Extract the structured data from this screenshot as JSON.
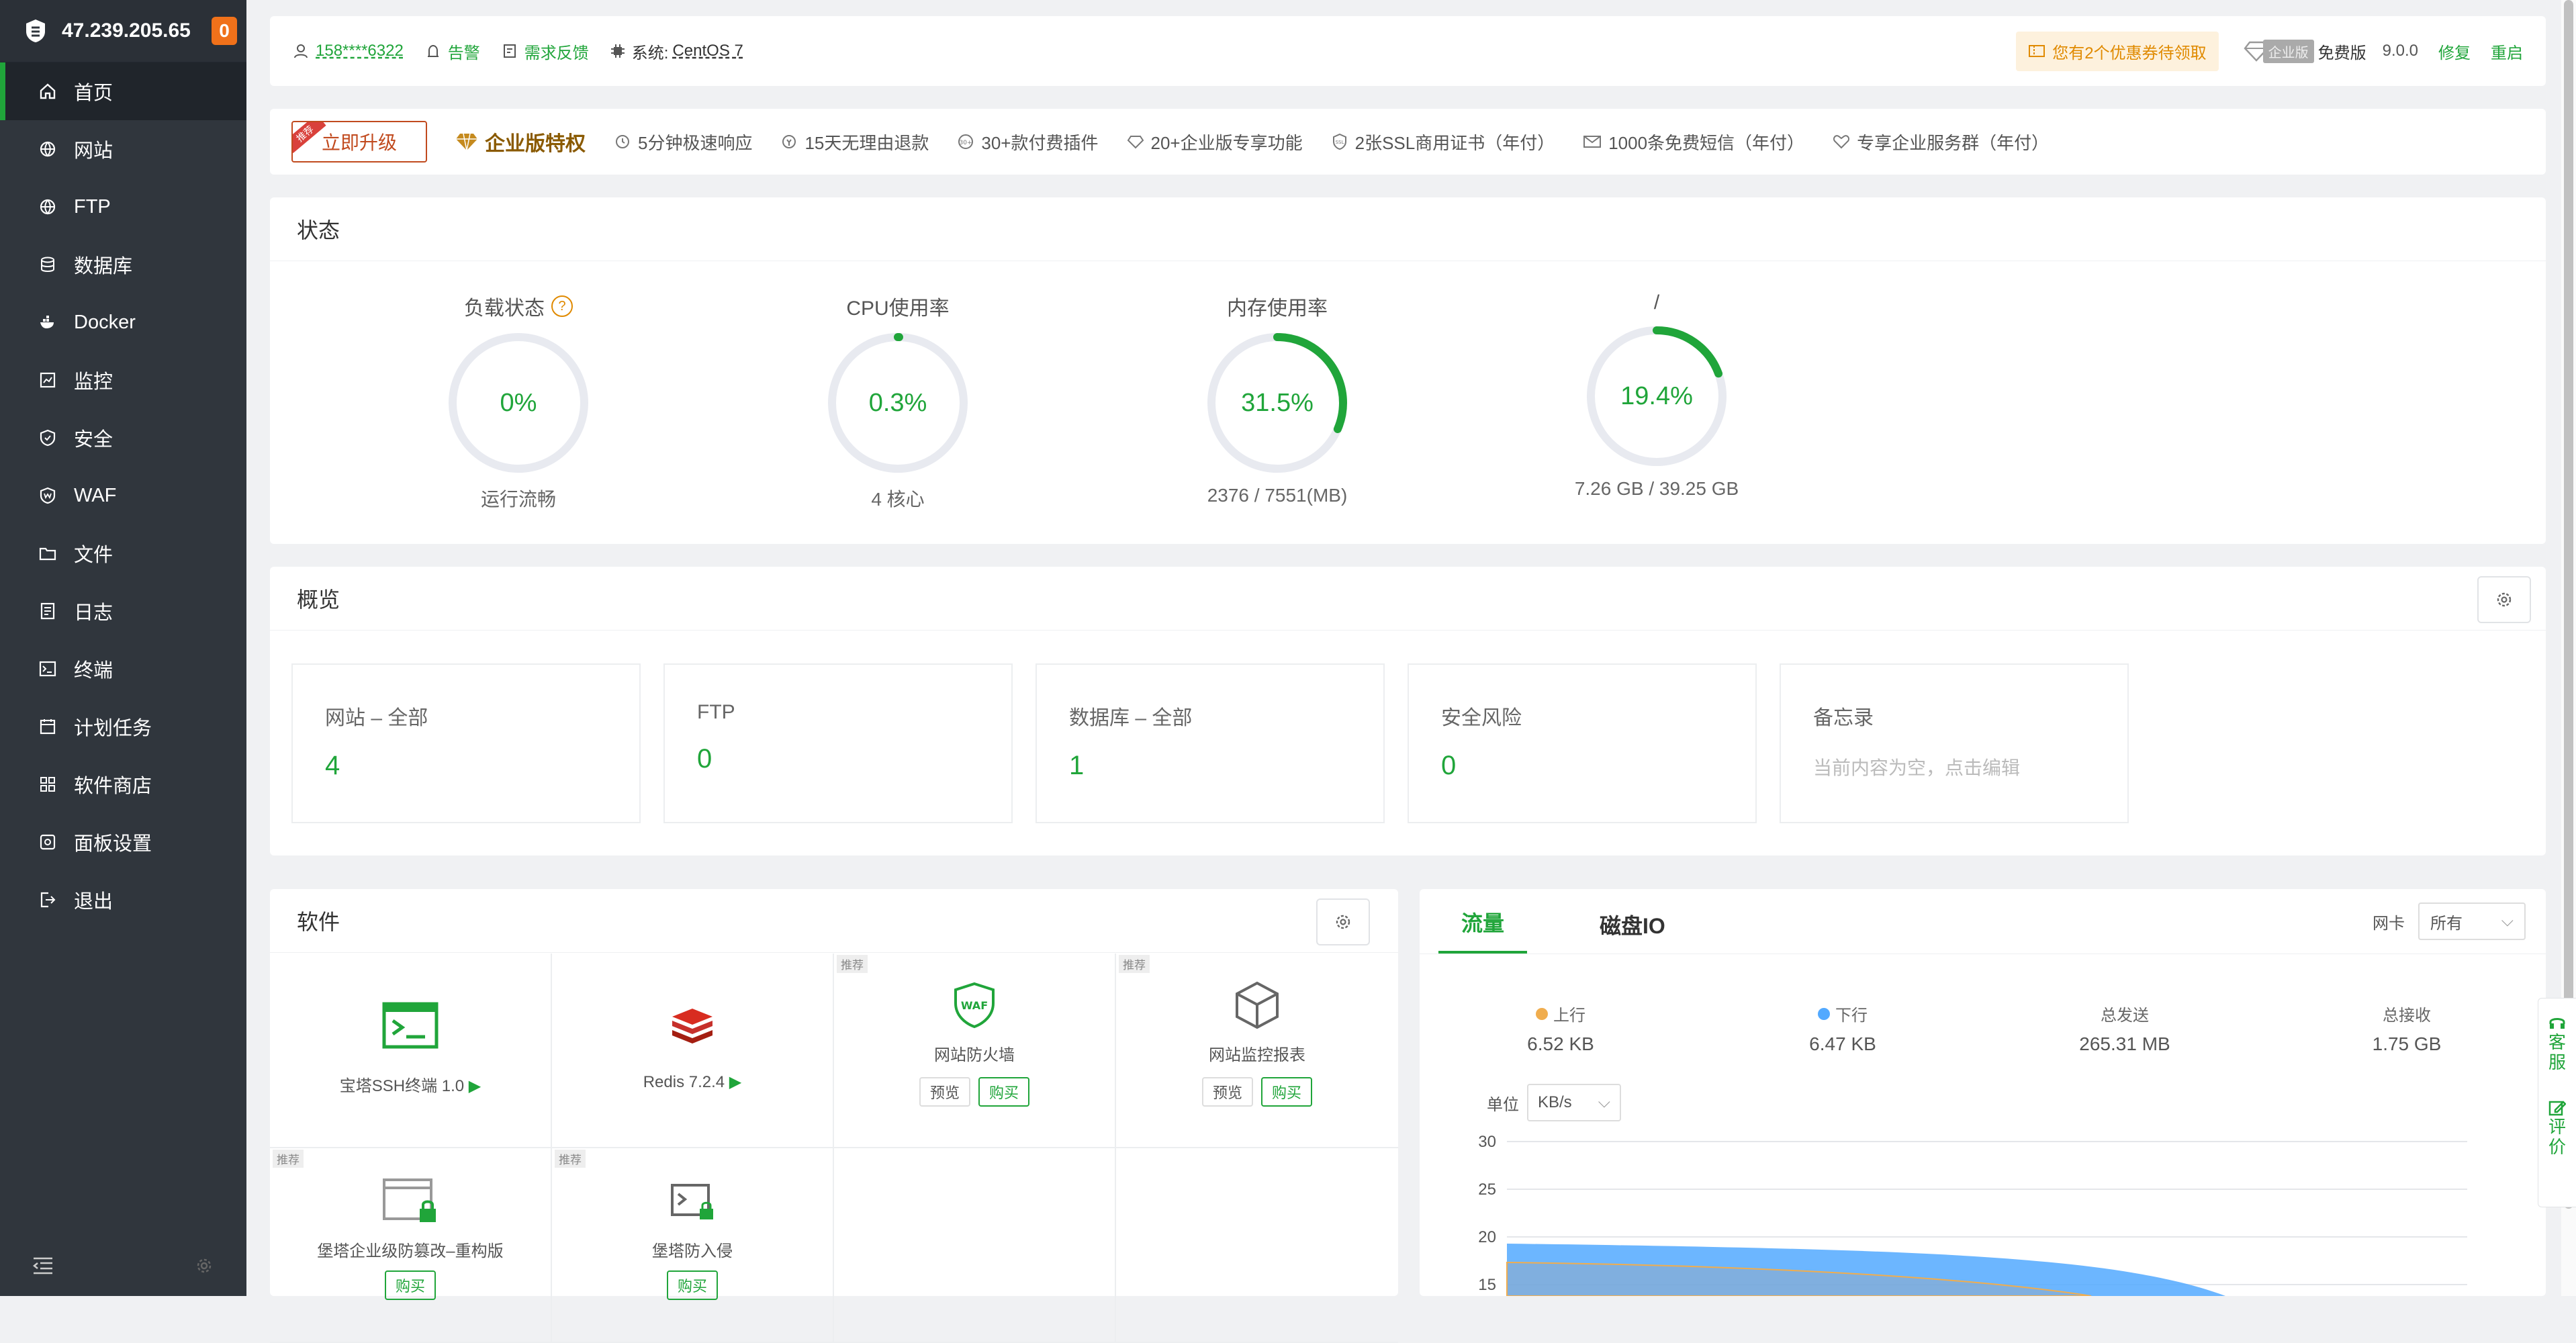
{
  "sidebar": {
    "ip": "47.239.205.65",
    "badge_count": "0",
    "items": [
      {
        "label": "首页",
        "icon": "home-icon",
        "active": true
      },
      {
        "label": "网站",
        "icon": "globe-icon"
      },
      {
        "label": "FTP",
        "icon": "globe-icon"
      },
      {
        "label": "数据库",
        "icon": "database-icon"
      },
      {
        "label": "Docker",
        "icon": "docker-icon"
      },
      {
        "label": "监控",
        "icon": "monitor-icon"
      },
      {
        "label": "安全",
        "icon": "shield-icon"
      },
      {
        "label": "WAF",
        "icon": "waf-icon"
      },
      {
        "label": "文件",
        "icon": "folder-icon"
      },
      {
        "label": "日志",
        "icon": "log-icon"
      },
      {
        "label": "终端",
        "icon": "terminal-icon"
      },
      {
        "label": "计划任务",
        "icon": "calendar-icon"
      },
      {
        "label": "软件商店",
        "icon": "apps-icon"
      },
      {
        "label": "面板设置",
        "icon": "settings-icon"
      },
      {
        "label": "退出",
        "icon": "logout-icon"
      }
    ]
  },
  "topbar": {
    "user": "158****6322",
    "alarm": "告警",
    "feedback": "需求反馈",
    "system_label": "系统:",
    "system_value": "CentOS 7",
    "coupon": "您有2个优惠券待领取",
    "edition_tag": "企业版",
    "edition": "免费版",
    "version": "9.0.0",
    "repair": "修复",
    "restart": "重启"
  },
  "promo": {
    "upgrade": "立即升级",
    "ribbon": "推荐",
    "title": "企业版特权",
    "items": [
      "5分钟极速响应",
      "15天无理由退款",
      "30+款付费插件",
      "20+企业版专享功能",
      "2张SSL商用证书（年付）",
      "1000条免费短信（年付）",
      "专享企业服务群（年付）"
    ]
  },
  "status": {
    "title": "状态",
    "gauges": [
      {
        "label": "负载状态",
        "value": "0%",
        "percent": 0,
        "sub": "运行流畅",
        "help": "?"
      },
      {
        "label": "CPU使用率",
        "value": "0.3%",
        "percent": 0.3,
        "sub": "4 核心"
      },
      {
        "label": "内存使用率",
        "value": "31.5%",
        "percent": 31.5,
        "sub": "2376 / 7551(MB)"
      },
      {
        "label": "/",
        "value": "19.4%",
        "percent": 19.4,
        "sub": "7.26 GB / 39.25 GB"
      }
    ]
  },
  "overview": {
    "title": "概览",
    "boxes": [
      {
        "title": "网站 – 全部",
        "value": "4"
      },
      {
        "title": "FTP",
        "value": "0"
      },
      {
        "title": "数据库 – 全部",
        "value": "1"
      },
      {
        "title": "安全风险",
        "value": "0"
      },
      {
        "title": "备忘录",
        "memo": "当前内容为空，点击编辑"
      }
    ]
  },
  "software": {
    "title": "软件",
    "rec_tag": "推荐",
    "preview": "预览",
    "buy": "购买",
    "items": [
      {
        "name": "宝塔SSH终端 1.0"
      },
      {
        "name": "Redis 7.2.4"
      },
      {
        "name": "网站防火墙"
      },
      {
        "name": "网站监控报表"
      },
      {
        "name": "堡塔企业级防篡改–重构版"
      },
      {
        "name": "堡塔防入侵"
      }
    ]
  },
  "traffic": {
    "tabs": [
      "流量",
      "磁盘IO"
    ],
    "nic_label": "网卡",
    "nic_value": "所有",
    "stats": [
      {
        "label": "上行",
        "value": "6.52 KB",
        "color": "#f0ad4e"
      },
      {
        "label": "下行",
        "value": "6.47 KB",
        "color": "#52a9ff"
      },
      {
        "label": "总发送",
        "value": "265.31 MB"
      },
      {
        "label": "总接收",
        "value": "1.75 GB"
      }
    ],
    "unit_label": "单位",
    "unit_value": "KB/s"
  },
  "chart_data": {
    "type": "area",
    "y_ticks": [
      "30",
      "25",
      "20",
      "15"
    ],
    "ylim": [
      0,
      30
    ],
    "series": [
      {
        "name": "上行",
        "color": "#f0ad4e"
      },
      {
        "name": "下行",
        "color": "#52a9ff"
      }
    ]
  },
  "right_tools": {
    "service": "客服",
    "review": "评价"
  }
}
